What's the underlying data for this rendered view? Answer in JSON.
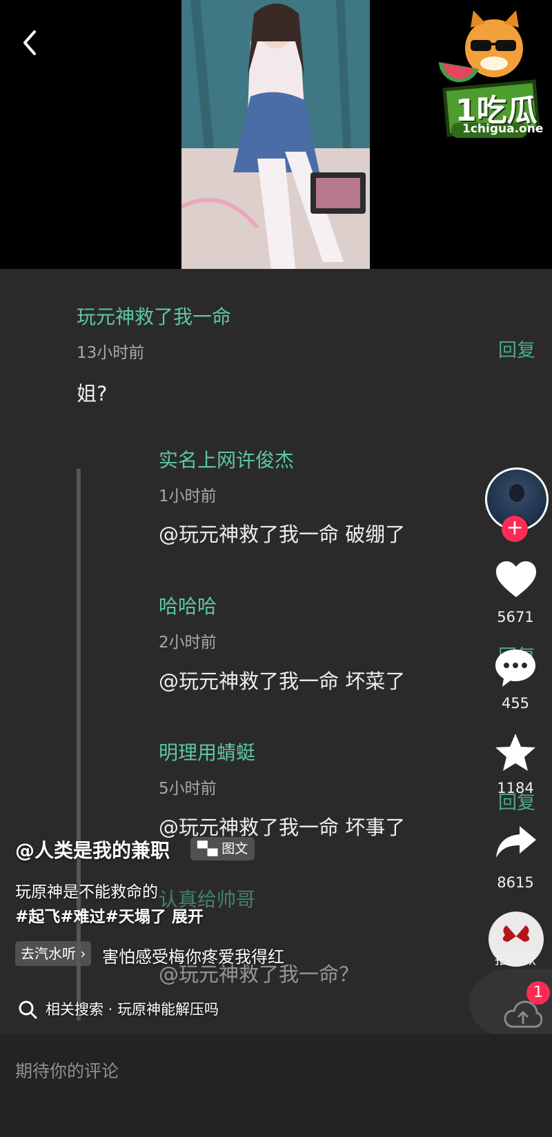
{
  "watermark": {
    "brand": "1吃瓜",
    "site": "1chigua.one"
  },
  "thread": {
    "top": {
      "user": "玩元神救了我一命",
      "time": "13小时前",
      "text": "姐?",
      "reply_label": "回复"
    },
    "replies": [
      {
        "user": "实名上网许俊杰",
        "time": "1小时前",
        "text": "@玩元神救了我一命 破绷了"
      },
      {
        "user": "哈哈哈",
        "time": "2小时前",
        "text": "@玩元神救了我一命 坏菜了"
      },
      {
        "user": "明理用蜻蜓",
        "time": "5小时前",
        "text": "@玩元神救了我一命 坏事了"
      },
      {
        "user": "认真给帅哥",
        "text": "@玩元神救了我一命？"
      }
    ],
    "reply_labels": [
      "回复",
      "回复"
    ]
  },
  "sidebar": {
    "likes": "5671",
    "comments": "455",
    "favorites": "1184",
    "shares": "8615",
    "same_style": "拍同款",
    "notification_badge": "1"
  },
  "overlay": {
    "author": "@人类是我的兼职",
    "image_tag": "图文",
    "caption": "玩原神是不能救命的",
    "hashtags": "#起飞#难过#天塌了",
    "expand": "展开",
    "music_tag": "去汽水听",
    "music": "害怕感受梅你疼爱我得红",
    "related_search_label": "相关搜索 · 玩原神能解压吗"
  },
  "input": {
    "placeholder": "期待你的评论"
  },
  "colors": {
    "accent": "#5ec7a6",
    "like_red": "#fe2c55"
  }
}
